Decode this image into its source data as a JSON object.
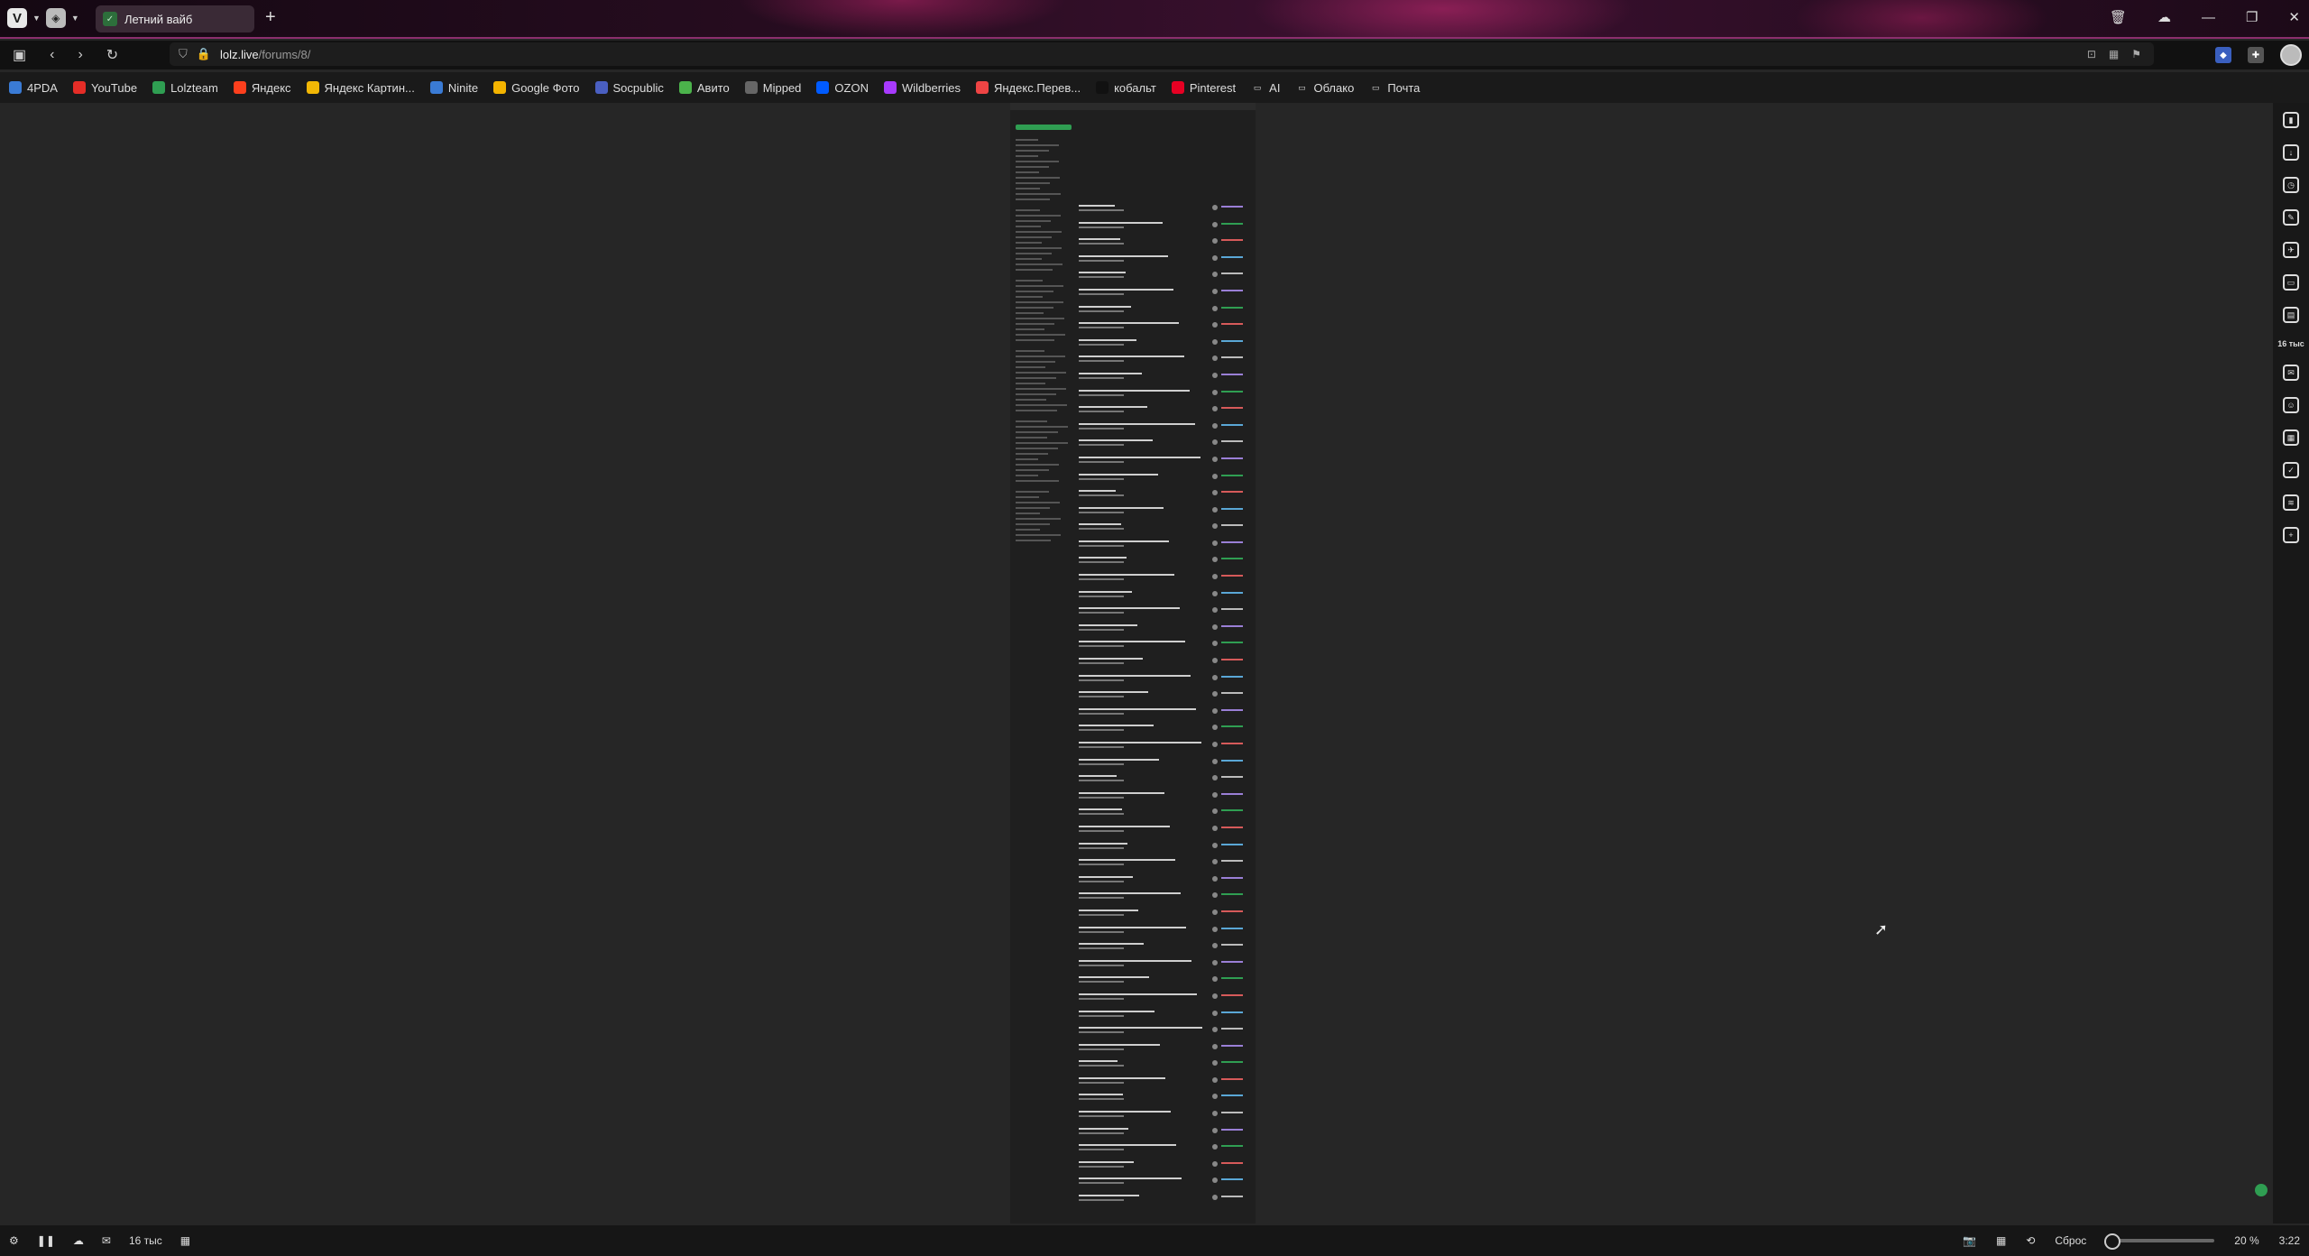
{
  "titlebar": {
    "tab_title": "Летний вайб",
    "icons": [
      "vivaldi-icon",
      "workspace-icon",
      "trash-icon",
      "cloud-icon",
      "minimize-icon",
      "restore-icon",
      "close-icon"
    ]
  },
  "address": {
    "host": "lolz.live",
    "path": "/forums/8/"
  },
  "bookmarks": [
    {
      "label": "4PDA",
      "color": "#3a7bd5",
      "icon": "4pda-icon"
    },
    {
      "label": "YouTube",
      "color": "#e52d27",
      "icon": "youtube-icon"
    },
    {
      "label": "Lolzteam",
      "color": "#2f9e52",
      "icon": "lolzteam-icon"
    },
    {
      "label": "Яндекс",
      "color": "#fc3f1d",
      "icon": "yandex-icon"
    },
    {
      "label": "Яндекс Картин...",
      "color": "#f2b705",
      "icon": "yandex-images-icon"
    },
    {
      "label": "Ninite",
      "color": "#3a7bd5",
      "icon": "ninite-icon"
    },
    {
      "label": "Google Фото",
      "color": "#f4b400",
      "icon": "google-photos-icon"
    },
    {
      "label": "Socpublic",
      "color": "#4a5fc1",
      "icon": "socpublic-icon"
    },
    {
      "label": "Авито",
      "color": "#4bb34b",
      "icon": "avito-icon"
    },
    {
      "label": "Mipped",
      "color": "#666",
      "icon": "mipped-icon"
    },
    {
      "label": "OZON",
      "color": "#005bff",
      "icon": "ozon-icon"
    },
    {
      "label": "Wildberries",
      "color": "#a73afd",
      "icon": "wildberries-icon"
    },
    {
      "label": "Яндекс.Перев...",
      "color": "#e44",
      "icon": "yandex-translate-icon"
    },
    {
      "label": "кобальт",
      "color": "#111",
      "icon": "cobalt-icon"
    },
    {
      "label": "Pinterest",
      "color": "#e60023",
      "icon": "pinterest-icon"
    },
    {
      "label": "AI",
      "color": "transparent",
      "icon": "folder-icon"
    },
    {
      "label": "Облако",
      "color": "transparent",
      "icon": "folder-icon"
    },
    {
      "label": "Почта",
      "color": "transparent",
      "icon": "folder-icon"
    }
  ],
  "sidepanel": {
    "badge": "16 тыс"
  },
  "statusbar": {
    "mail_count": "16 тыс",
    "reset_label": "Сброс",
    "zoom": "20 %",
    "time": "3:22"
  }
}
